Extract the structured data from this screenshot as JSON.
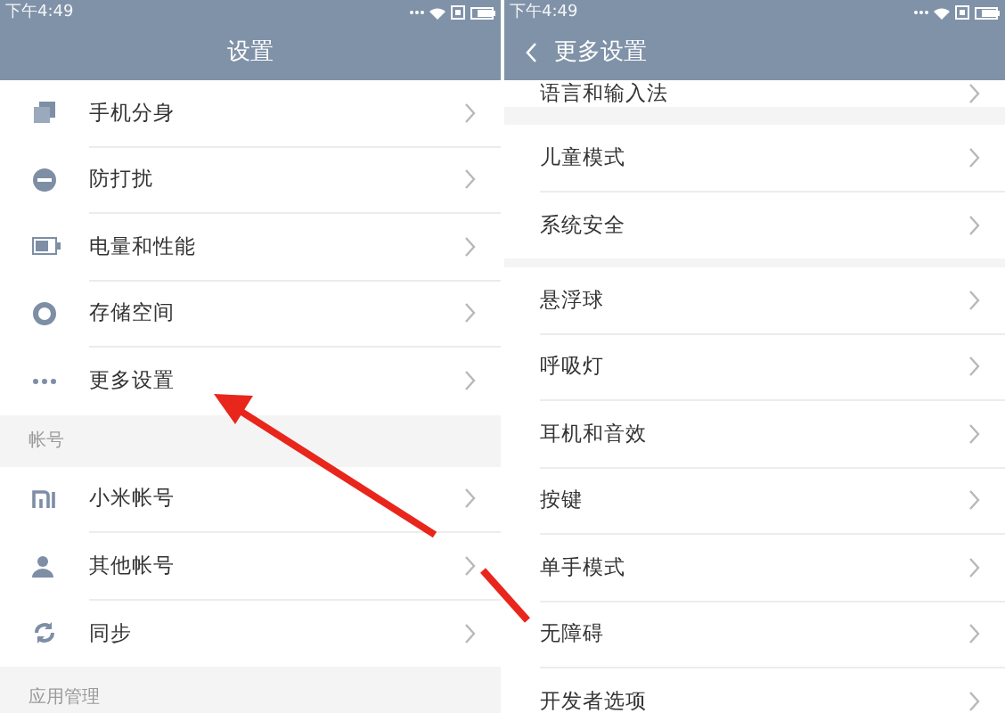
{
  "panels": [
    {
      "status_bar": {
        "time": "下午4:49"
      },
      "header": {
        "title": "设置",
        "back": false
      },
      "sections": [
        {
          "items": [
            {
              "label": "手机分身",
              "kind": "clone"
            },
            {
              "label": "防打扰",
              "kind": "minus"
            },
            {
              "label": "电量和性能",
              "kind": "battery"
            },
            {
              "label": "存储空间",
              "kind": "ring"
            },
            {
              "label": "更多设置",
              "kind": "dots"
            }
          ]
        },
        {
          "label": "帐号",
          "items": [
            {
              "label": "小米帐号",
              "kind": "mi"
            },
            {
              "label": "其他帐号",
              "kind": "person"
            },
            {
              "label": "同步",
              "kind": "sync"
            }
          ]
        },
        {
          "label": "应用管理"
        }
      ]
    },
    {
      "status_bar": {
        "time": "下午4:49"
      },
      "header": {
        "title": "更多设置",
        "back": true
      },
      "sections": [
        {
          "partial": true,
          "items": [
            {
              "label": "语言和输入法"
            }
          ]
        },
        {
          "items": [
            {
              "label": "儿童模式"
            },
            {
              "label": "系统安全"
            }
          ]
        },
        {
          "items": [
            {
              "label": "悬浮球"
            },
            {
              "label": "呼吸灯"
            },
            {
              "label": "耳机和音效"
            },
            {
              "label": "按键"
            },
            {
              "label": "单手模式"
            },
            {
              "label": "无障碍"
            },
            {
              "label": "开发者选项"
            }
          ]
        }
      ]
    }
  ]
}
